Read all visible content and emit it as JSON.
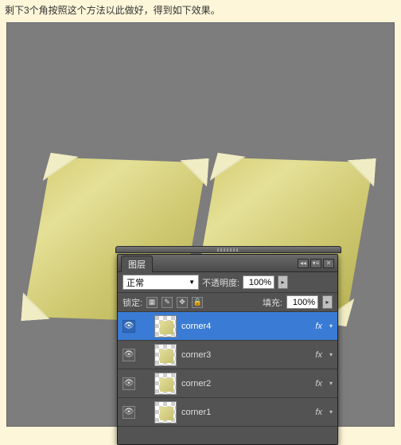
{
  "caption": "剩下3个角按照这个方法以此做好，得到如下效果。",
  "panel": {
    "title": "图层",
    "grip_icons": {
      "left": "◂◂",
      "menu": "▾≡",
      "close": "✕"
    },
    "blend_mode": "正常",
    "opacity_label": "不透明度:",
    "opacity_value": "100%",
    "lock_label": "锁定:",
    "lock_icons": {
      "transparent": "▦",
      "brush": "✎",
      "move": "✥",
      "all": "🔒"
    },
    "fill_label": "填充:",
    "fill_value": "100%",
    "step_glyph": "▸",
    "caret": "▼",
    "eye_glyph": "👁",
    "fx_label": "fx",
    "tri": "▾",
    "layers": [
      {
        "name": "corner4",
        "selected": true,
        "fx": true
      },
      {
        "name": "corner3",
        "selected": false,
        "fx": true
      },
      {
        "name": "corner2",
        "selected": false,
        "fx": true
      },
      {
        "name": "corner1",
        "selected": false,
        "fx": true
      }
    ]
  }
}
